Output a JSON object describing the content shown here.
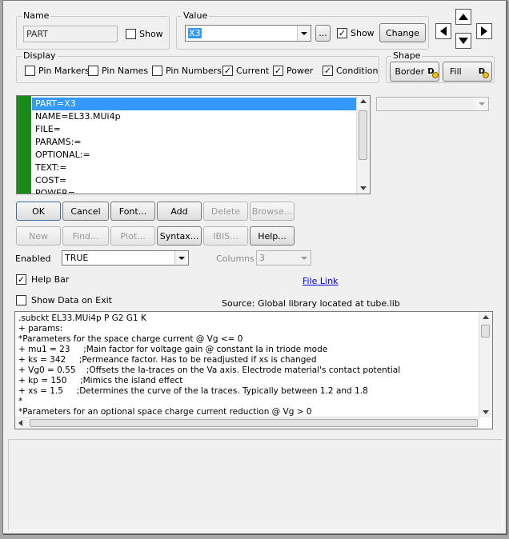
{
  "name_group": {
    "title": "Name",
    "value": "PART",
    "show_label": "Show",
    "show_checked": false
  },
  "value_group": {
    "title": "Value",
    "value": "X3",
    "ellipsis": "...",
    "show_label": "Show",
    "show_checked": true,
    "change_label": "Change"
  },
  "display_group": {
    "title": "Display",
    "options": [
      {
        "label": "Pin Markers",
        "checked": false
      },
      {
        "label": "Pin Names",
        "checked": false
      },
      {
        "label": "Pin Numbers",
        "checked": false
      },
      {
        "label": "Current",
        "checked": true
      },
      {
        "label": "Power",
        "checked": true
      },
      {
        "label": "Condition",
        "checked": true
      }
    ]
  },
  "shape_group": {
    "title": "Shape",
    "border_label": "Border",
    "fill_label": "Fill",
    "d_glyph": "D"
  },
  "attributes": [
    "PART=X3",
    "NAME=EL33.MUi4p",
    "FILE=",
    "PARAMS:=",
    "OPTIONAL:=",
    "TEXT:=",
    "COST=",
    "POWER="
  ],
  "buttons_row1": {
    "ok": "OK",
    "cancel": "Cancel",
    "font": "Font...",
    "add": "Add",
    "delete": "Delete",
    "browse": "Browse..."
  },
  "buttons_row2": {
    "new": "New",
    "find": "Find...",
    "plot": "Plot...",
    "syntax": "Syntax...",
    "ibis": "IBIS...",
    "help": "Help..."
  },
  "enabled": {
    "label": "Enabled",
    "value": "TRUE"
  },
  "columns": {
    "label": "Columns",
    "value": "3"
  },
  "help_bar": {
    "label": "Help Bar",
    "checked": true
  },
  "file_link": "File Link",
  "show_data_on_exit": {
    "label": "Show Data on Exit",
    "checked": false
  },
  "source_text": "Source: Global library located at tube.lib",
  "code_lines": [
    ".subckt EL33.MUi4p P G2 G1 K",
    "+ params:",
    "*Parameters for the space charge current @ Vg <= 0",
    "+ mu1 = 23     ;Main factor for voltage gain @ constant Ia in triode mode",
    "+ ks = 342     ;Permeance factor. Has to be readjusted if xs is changed",
    "+ Vg0 = 0.55    ;Offsets the Ia-traces on the Va axis. Electrode material's contact potential",
    "+ kp = 150     ;Mimics the island effect",
    "+ xs = 1.5     ;Determines the curve of the Ia traces. Typically between 1.2 and 1.8",
    "*",
    "*Parameters for an optional space charge current reduction @ Vg > 0"
  ],
  "colors": {
    "selection": "#3399ff",
    "green_bar": "#1a8a1a",
    "link": "#0000ee"
  }
}
